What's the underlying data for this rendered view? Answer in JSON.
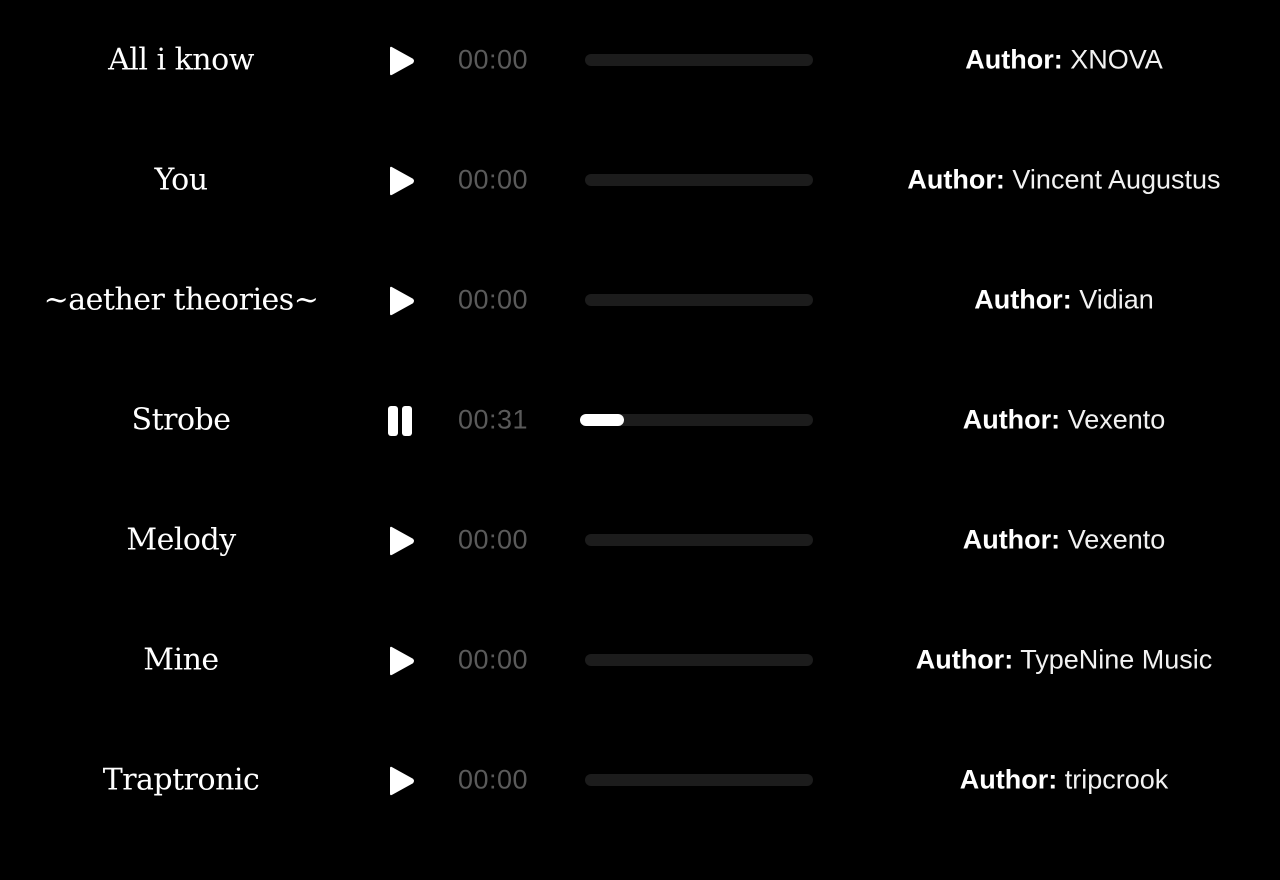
{
  "author_prefix": "Author:",
  "colors": {
    "background": "#000000",
    "text": "#ffffff",
    "time_text": "#5a5a5a",
    "track_bg": "#1c1c1c",
    "track_fill": "#ffffff"
  },
  "tracks": [
    {
      "title": "All i know",
      "time": "00:00",
      "author": "XNOVA",
      "state": "paused",
      "icon": "play-icon",
      "progress": 0
    },
    {
      "title": "You",
      "time": "00:00",
      "author": "Vincent Augustus",
      "state": "paused",
      "icon": "play-icon",
      "progress": 0
    },
    {
      "title": "~aether theories~",
      "time": "00:00",
      "author": "Vidian",
      "state": "paused",
      "icon": "play-icon",
      "progress": 0
    },
    {
      "title": "Strobe",
      "time": "00:31",
      "author": "Vexento",
      "state": "playing",
      "icon": "pause-icon",
      "progress": 0.17
    },
    {
      "title": "Melody",
      "time": "00:00",
      "author": "Vexento",
      "state": "paused",
      "icon": "play-icon",
      "progress": 0
    },
    {
      "title": "Mine",
      "time": "00:00",
      "author": "TypeNine Music",
      "state": "paused",
      "icon": "play-icon",
      "progress": 0
    },
    {
      "title": "Traptronic",
      "time": "00:00",
      "author": "tripcrook",
      "state": "paused",
      "icon": "play-icon",
      "progress": 0
    }
  ]
}
